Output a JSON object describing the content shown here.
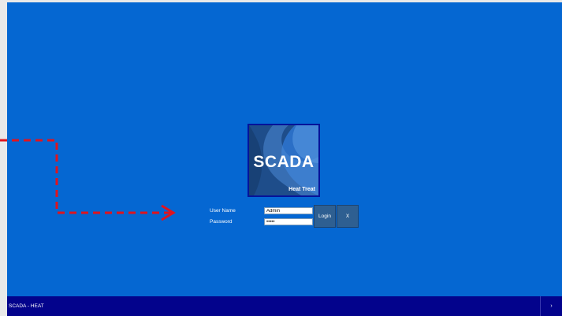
{
  "app": {
    "taskbar_title": "SCADA - HEAT",
    "taskbar_arrow_glyph": "›"
  },
  "logo": {
    "title": "SCADA",
    "subtitle": "Heat Treat"
  },
  "login": {
    "username_label": "User Name",
    "username_value": "Admin",
    "password_label": "Password",
    "password_value": "•••••",
    "login_button": "Login",
    "close_button": "X"
  },
  "colors": {
    "background": "#0567d2",
    "taskbar": "#03038c",
    "button": "#2e5f91",
    "annotation_arrow": "#e0141e"
  }
}
